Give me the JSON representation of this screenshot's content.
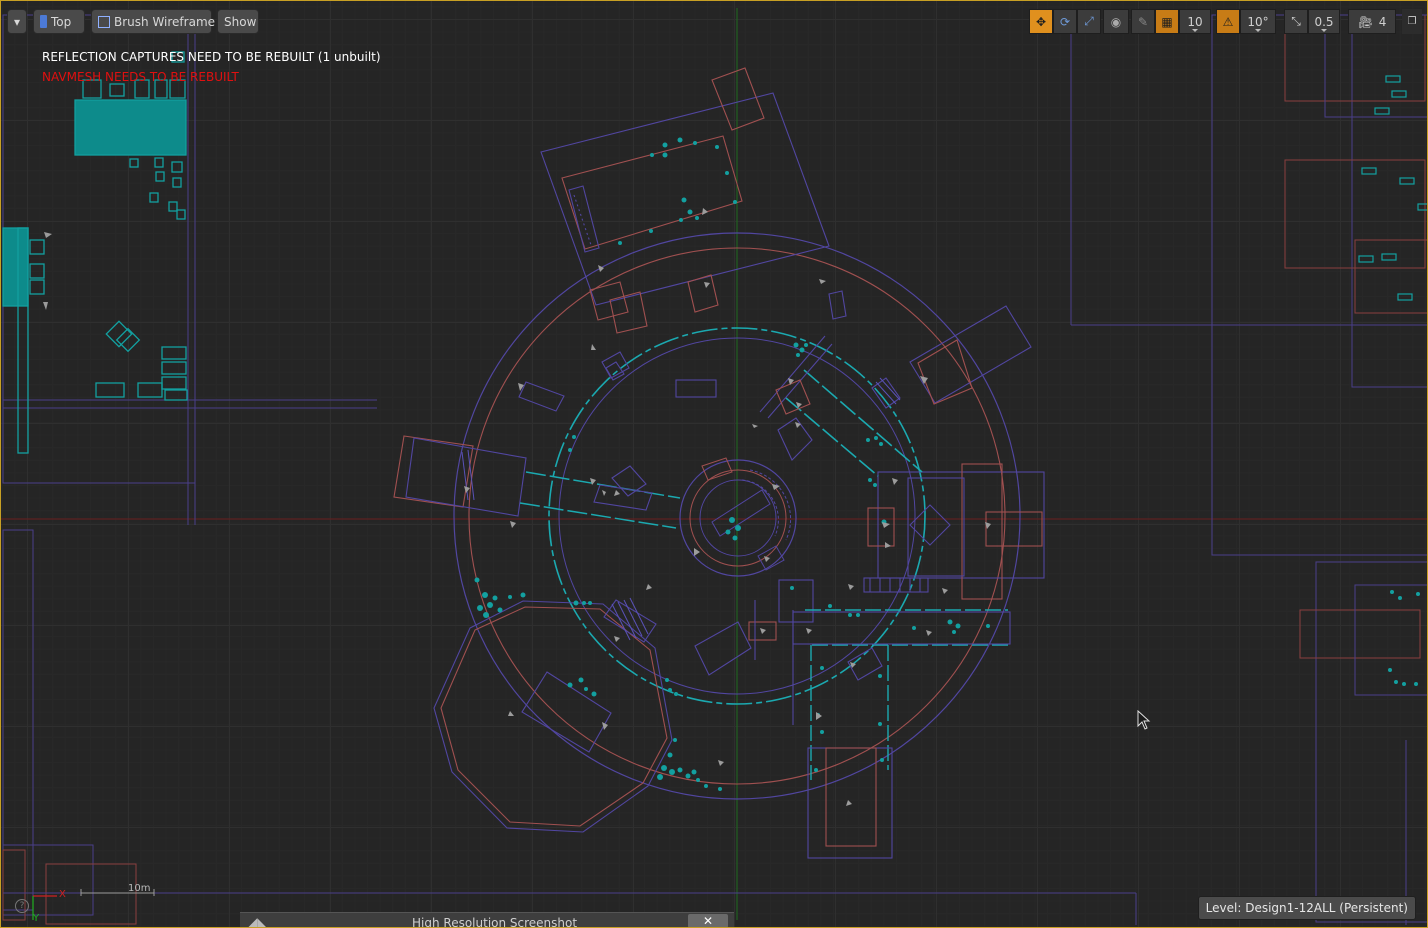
{
  "toolbar": {
    "menu_label": "▾",
    "view_label": "Top",
    "view_mode_label": "Brush Wireframe",
    "show_label": "Show",
    "grid_snap_value": "10",
    "rotation_snap_value": "10°",
    "scale_snap_value": "0.5",
    "camera_speed_value": "4"
  },
  "messages": {
    "reflection": "REFLECTION CAPTURES NEED TO BE REBUILT (1 unbuilt)",
    "navmesh": "NAVMESH NEEDS TO BE REBUILT"
  },
  "colors": {
    "reflection": "#ffffff",
    "navmesh": "#e01010",
    "accent": "#e0901e",
    "frame": "#c8a024"
  },
  "axis": {
    "x_label": "X",
    "y_label": "Y"
  },
  "scale": {
    "label": "10m"
  },
  "level": {
    "label": "Level:  Design1-12ALL (Persistent)"
  },
  "hrs_panel": {
    "title": "High Resolution Screenshot",
    "close_label": "✕"
  },
  "icons": [
    "menu-chevron-icon",
    "perspective-cube-icon",
    "wireframe-icon",
    "translate-icon",
    "rotate-icon",
    "scale-icon",
    "world-local-icon",
    "surface-snap-icon",
    "grid-icon",
    "rotation-snap-icon",
    "scale-snap-icon",
    "camera-speed-icon",
    "maximize-icon",
    "help-icon",
    "cursor-icon"
  ]
}
